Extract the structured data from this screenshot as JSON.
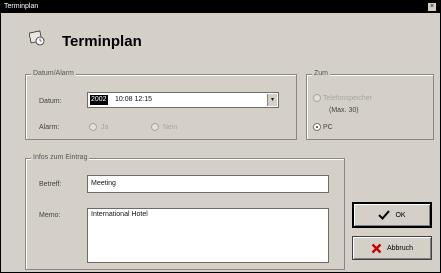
{
  "window": {
    "title": "Terminplan",
    "close_glyph": "×"
  },
  "header": {
    "title": "Terminplan",
    "icon": "calendar-clock-icon"
  },
  "date_group": {
    "legend": "Datum/Alarm",
    "date_label": "Datum:",
    "date_value_prefix": "2002",
    "date_value": "10:08 12:15",
    "alarm_label": "Alarm:",
    "alarm_yes": "Ja",
    "alarm_no": "Nein"
  },
  "target_group": {
    "legend": "Zum",
    "option_phone": "Telefonspeicher",
    "option_phone_sub": "(Max. 30)",
    "option_pc": "PC"
  },
  "info_group": {
    "legend": "Infos zum Eintrag",
    "subject_label": "Betreff:",
    "subject_value": "Meeting",
    "memo_label": "Memo:",
    "memo_value": "International Hotel"
  },
  "buttons": {
    "ok_label": "OK",
    "cancel_label": "Abbruch"
  },
  "colors": {
    "window_bg": "#d4d0c8",
    "titlebar": "#000000",
    "accent_red": "#cc0000"
  }
}
